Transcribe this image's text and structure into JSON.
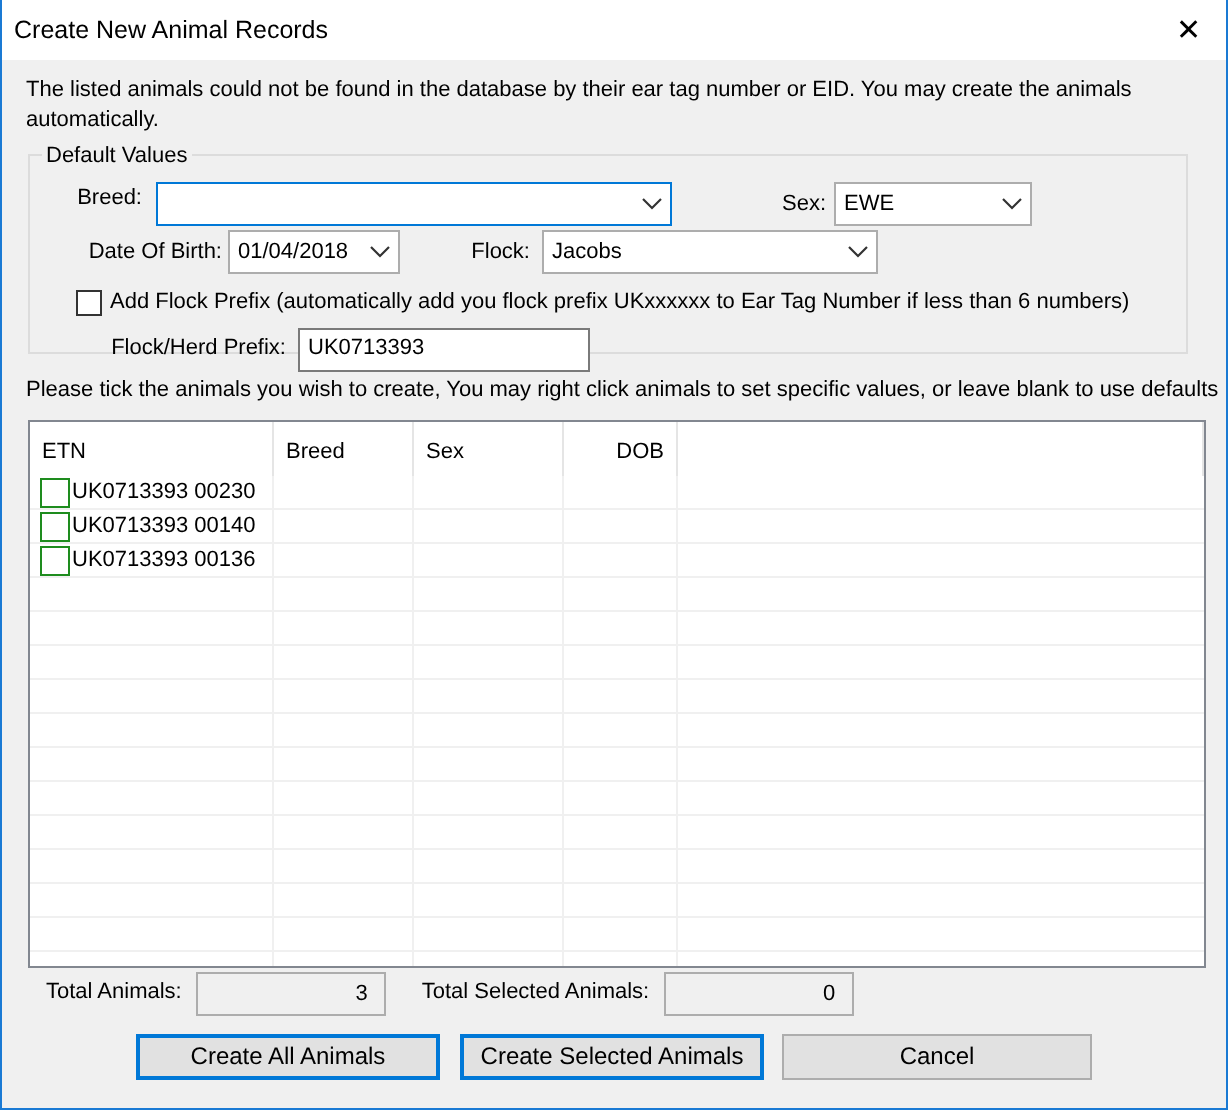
{
  "window": {
    "title": "Create  New Animal Records",
    "close": "✕"
  },
  "intro": "The listed animals could not be found in the database by their ear tag number or EID. You may create the animals automatically.",
  "defaults": {
    "title": "Default Values",
    "breed": {
      "label": "Breed:",
      "focused": true
    },
    "sex": {
      "label": "Sex:",
      "value": "EWE"
    },
    "dob": {
      "label": "Date Of Birth:",
      "value": "01/04/2018"
    },
    "flock": {
      "label": "Flock:",
      "value": "Jacobs"
    },
    "add_prefix": {
      "label": "Add Flock Prefix (automatically add you flock prefix UKxxxxxx to Ear Tag Number if less than 6 numbers)",
      "checked": false
    },
    "prefix": {
      "label": "Flock/Herd Prefix:",
      "value": "UK0713393"
    }
  },
  "instruction": "Please tick the animals you wish to create, You may right click animals to set specific values, or leave blank to use defaults",
  "table": {
    "columns": [
      {
        "label": "ETN"
      },
      {
        "label": "Breed"
      },
      {
        "label": "Sex"
      },
      {
        "label": "DOB"
      }
    ],
    "rows": [
      {
        "etn": "UK0713393 00230",
        "checked": false
      },
      {
        "etn": "UK0713393 00140",
        "checked": false
      },
      {
        "etn": "UK0713393 00136",
        "checked": false
      }
    ]
  },
  "totals": [
    {
      "label": "Total Animals:",
      "value": "3"
    },
    {
      "label": "Total Selected Animals:",
      "value": "0"
    }
  ],
  "buttons": [
    {
      "label": "Create All Animals",
      "focused": true
    },
    {
      "label": "Create Selected Animals",
      "focused": true
    },
    {
      "label": "Cancel",
      "focused": false
    }
  ]
}
